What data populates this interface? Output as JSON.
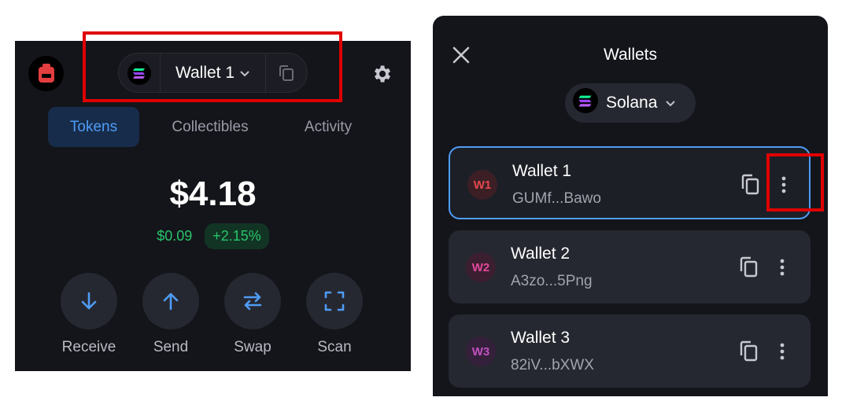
{
  "left_panel": {
    "wallet_selector": {
      "wallet_name": "Wallet 1"
    },
    "tabs": [
      {
        "label": "Tokens",
        "active": true
      },
      {
        "label": "Collectibles",
        "active": false
      },
      {
        "label": "Activity",
        "active": false
      }
    ],
    "balance": "$4.18",
    "change_usd": "$0.09",
    "change_pct": "+2.15%",
    "actions": [
      {
        "label": "Receive",
        "icon": "arrow-down-icon"
      },
      {
        "label": "Send",
        "icon": "arrow-up-icon"
      },
      {
        "label": "Swap",
        "icon": "swap-icon"
      },
      {
        "label": "Scan",
        "icon": "scan-icon"
      }
    ]
  },
  "right_panel": {
    "title": "Wallets",
    "chain_name": "Solana",
    "wallets": [
      {
        "initials": "W1",
        "name": "Wallet 1",
        "address": "GUMf...Bawo",
        "selected": true
      },
      {
        "initials": "W2",
        "name": "Wallet 2",
        "address": "A3zo...5Png",
        "selected": false
      },
      {
        "initials": "W3",
        "name": "Wallet 3",
        "address": "82iV...bXWX",
        "selected": false
      }
    ]
  },
  "colors": {
    "background": "#14151b",
    "accent": "#4e9cf5",
    "positive": "#29c46b",
    "highlight": "#e00000",
    "w1": "#e5484d",
    "w2": "#e5484d",
    "w3": "#c050c0"
  }
}
